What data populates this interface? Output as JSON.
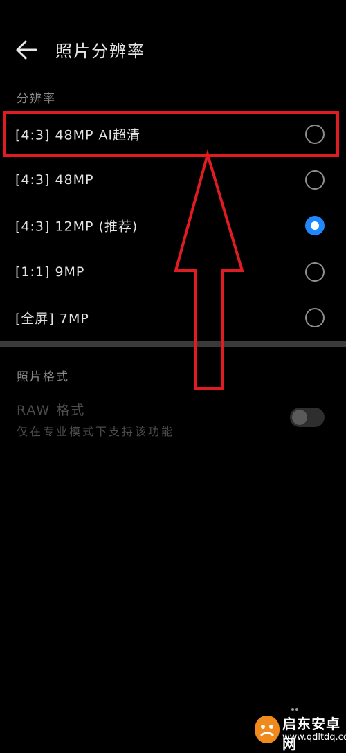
{
  "header": {
    "back_icon": "arrow-left-icon",
    "title": "照片分辨率"
  },
  "resolution_section": {
    "title": "分辨率",
    "options": [
      {
        "label": "[4:3] 48MP AI超清",
        "selected": false
      },
      {
        "label": "[4:3] 48MP",
        "selected": false
      },
      {
        "label": "[4:3] 12MP (推荐)",
        "selected": true
      },
      {
        "label": "[1:1] 9MP",
        "selected": false
      },
      {
        "label": "[全屏] 7MP",
        "selected": false
      }
    ]
  },
  "format_section": {
    "title": "照片格式",
    "raw": {
      "label": "RAW 格式",
      "description": "仅在专业模式下支持该功能",
      "enabled": false,
      "disabled": true
    }
  },
  "colors": {
    "accent": "#1e88ff",
    "annotation": "#e01b22"
  },
  "watermark": {
    "name": "启东安卓网",
    "url": "www.qdltdq.com"
  }
}
